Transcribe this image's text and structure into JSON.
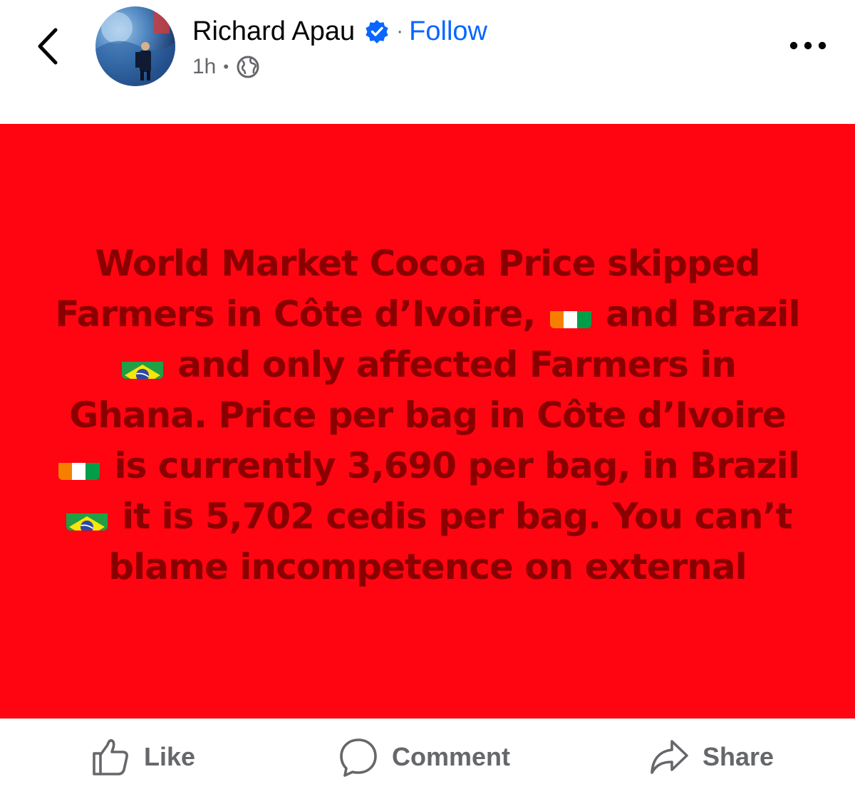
{
  "header": {
    "author_name": "Richard Apau",
    "separator": "·",
    "follow_label": "Follow",
    "post_time": "1h",
    "meta_separator": "•",
    "audience_icon": "globe-icon",
    "verified_icon": "verified-badge-icon",
    "more_icon": "more-options-icon"
  },
  "post": {
    "background_color": "#ff0411",
    "text_color": "#8a0000",
    "segments": {
      "s1": "World Market Cocoa Price skipped Farmers in Côte d’Ivoire,",
      "s2": "and Brazil",
      "s3": "and only affected Farmers in Ghana. Price per bag in Côte d’Ivoire",
      "s4": "is currently 3,690 per bag, in Brazil",
      "s5": "it is 5,702 cedis per bag. You can’t blame incompetence on external"
    },
    "flags": [
      "cote-divoire-flag",
      "brazil-flag",
      "cote-divoire-flag",
      "brazil-flag"
    ]
  },
  "actions": {
    "like_label": "Like",
    "comment_label": "Comment",
    "share_label": "Share"
  },
  "colors": {
    "accent": "#0866ff",
    "muted": "#65676b"
  }
}
